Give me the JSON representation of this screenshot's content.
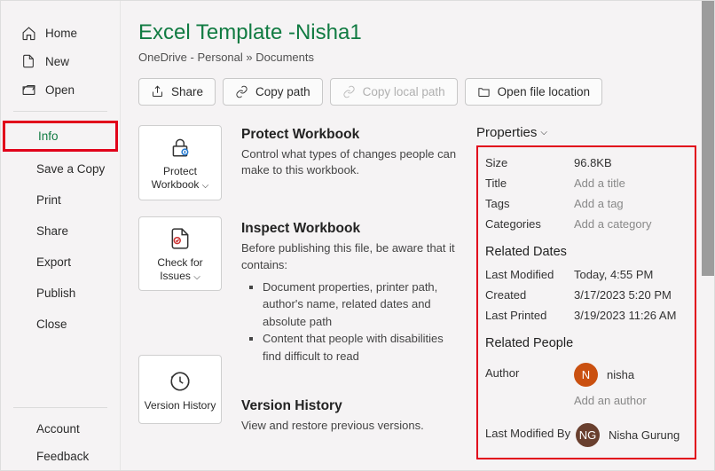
{
  "sidebar": {
    "home": "Home",
    "new": "New",
    "open": "Open",
    "info": "Info",
    "save_copy": "Save a Copy",
    "print": "Print",
    "share": "Share",
    "export": "Export",
    "publish": "Publish",
    "close": "Close",
    "account": "Account",
    "feedback": "Feedback"
  },
  "header": {
    "title": "Excel Template -Nisha1",
    "breadcrumb": "OneDrive - Personal » Documents"
  },
  "actions": {
    "share": "Share",
    "copy_path": "Copy path",
    "copy_local": "Copy local path",
    "open_loc": "Open file location"
  },
  "cards": {
    "protect": "Protect Workbook",
    "check": "Check for Issues",
    "version": "Version History"
  },
  "sections": {
    "protect": {
      "title": "Protect Workbook",
      "desc": "Control what types of changes people can make to this workbook."
    },
    "inspect": {
      "title": "Inspect Workbook",
      "desc": "Before publishing this file, be aware that it contains:",
      "b1": "Document properties, printer path, author's name, related dates and absolute path",
      "b2": "Content that people with disabilities find difficult to read"
    },
    "version": {
      "title": "Version History",
      "desc": "View and restore previous versions."
    }
  },
  "props": {
    "heading": "Properties",
    "size_k": "Size",
    "size_v": "96.8KB",
    "title_k": "Title",
    "title_p": "Add a title",
    "tags_k": "Tags",
    "tags_p": "Add a tag",
    "cat_k": "Categories",
    "cat_p": "Add a category",
    "dates_h": "Related Dates",
    "lm_k": "Last Modified",
    "lm_v": "Today, 4:55 PM",
    "cr_k": "Created",
    "cr_v": "3/17/2023 5:20 PM",
    "lp_k": "Last Printed",
    "lp_v": "3/19/2023 11:26 AM",
    "people_h": "Related People",
    "author_k": "Author",
    "author_name": "nisha",
    "author_init": "N",
    "add_author": "Add an author",
    "lmb_k": "Last Modified By",
    "lmb_name": "Nisha Gurung",
    "lmb_init": "NG"
  }
}
